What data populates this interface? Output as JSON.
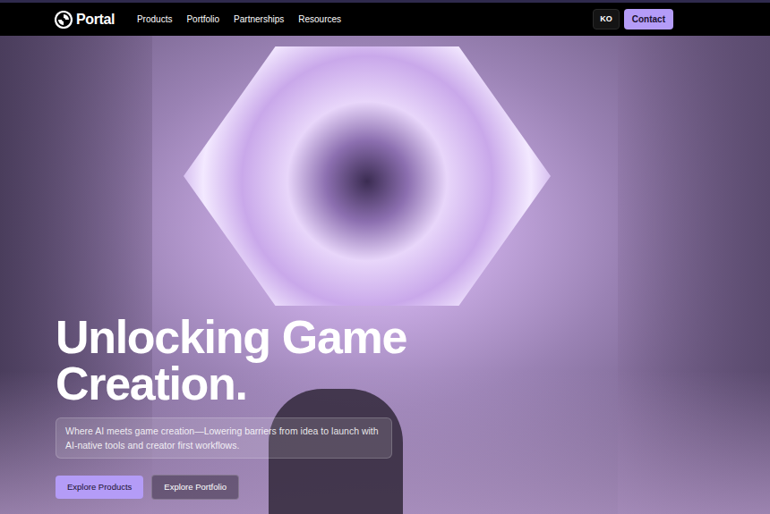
{
  "nav": {
    "logo": "Portal",
    "links": [
      "Products",
      "Portfolio",
      "Partnerships",
      "Resources"
    ],
    "language": "KO",
    "contact": "Contact"
  },
  "hero": {
    "title_lines": [
      "Unlocking Game",
      "Creation."
    ],
    "subtitle": "Where AI meets game creation—Lowering barriers from idea to launch with AI-native tools and creator first workflows.",
    "buttons": [
      {
        "label": "Explore Products",
        "kind": "primary"
      },
      {
        "label": "Explore Portfolio",
        "kind": "secondary"
      }
    ]
  }
}
